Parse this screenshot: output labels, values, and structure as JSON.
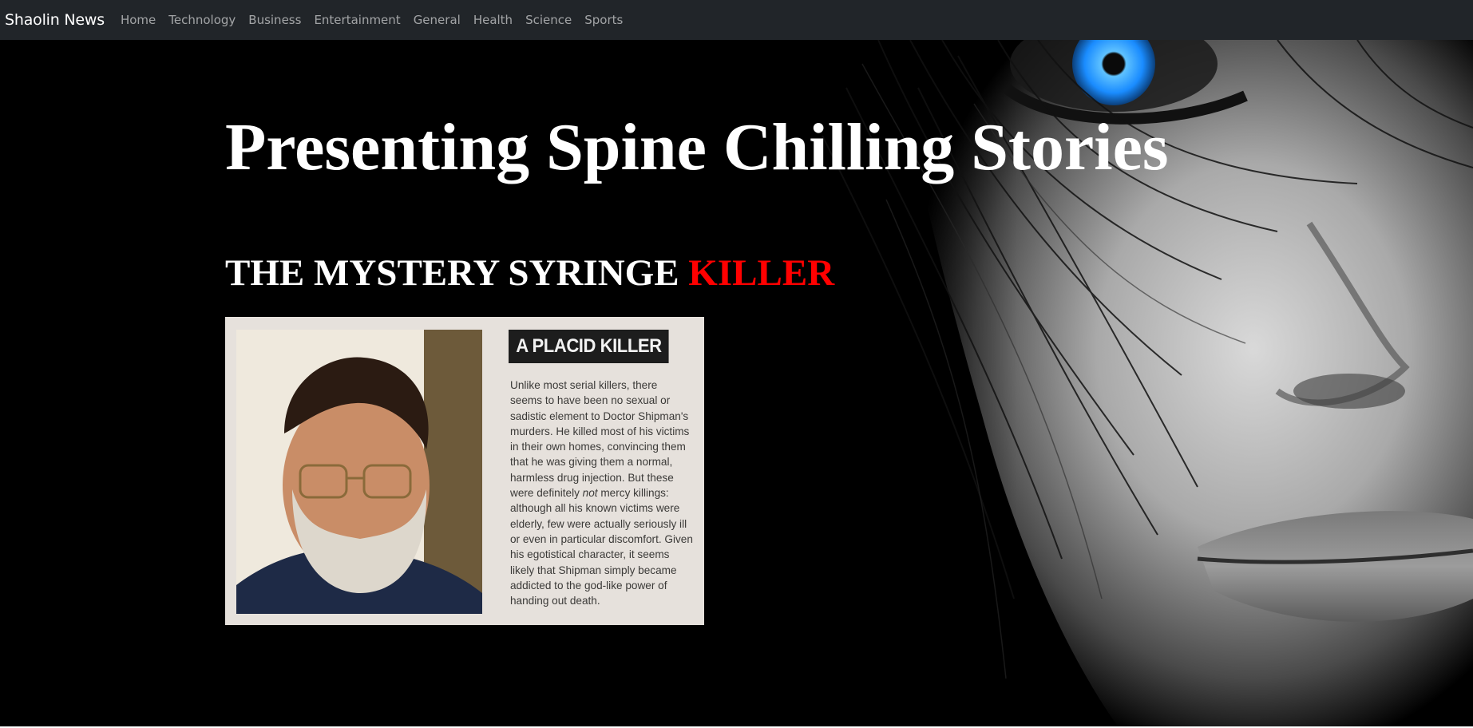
{
  "navbar": {
    "brand": "Shaolin News",
    "links": [
      "Home",
      "Technology",
      "Business",
      "Entertainment",
      "General",
      "Health",
      "Science",
      "Sports"
    ]
  },
  "hero": {
    "title": "Presenting Spine Chilling Stories",
    "story_title_main": "THE MYSTERY SYRINGE ",
    "story_title_accent": "KILLER"
  },
  "clipping": {
    "heading": "A PLACID KILLER",
    "lines": [
      "Unlike most serial killers, there",
      "seems to have been no sexual or",
      "sadistic element to Doctor Shipman's",
      "murders. He killed most of his victims",
      "in their own homes, convincing them",
      "that he was giving them a normal,",
      "harmless drug injection. But these",
      "were definitely ",
      "although all his known victims were",
      "elderly, few were actually seriously ill",
      "or even in particular discomfort. Given",
      "his egotistical character, it seems",
      "likely that Shipman simply became",
      "addicted to the god-like power of",
      "handing out death."
    ],
    "line8_italic": "not",
    "line8_tail": " mercy killings:"
  },
  "colors": {
    "navbar_bg": "#212529",
    "accent_red": "#ff0000",
    "eye_blue": "#1a8cff"
  }
}
